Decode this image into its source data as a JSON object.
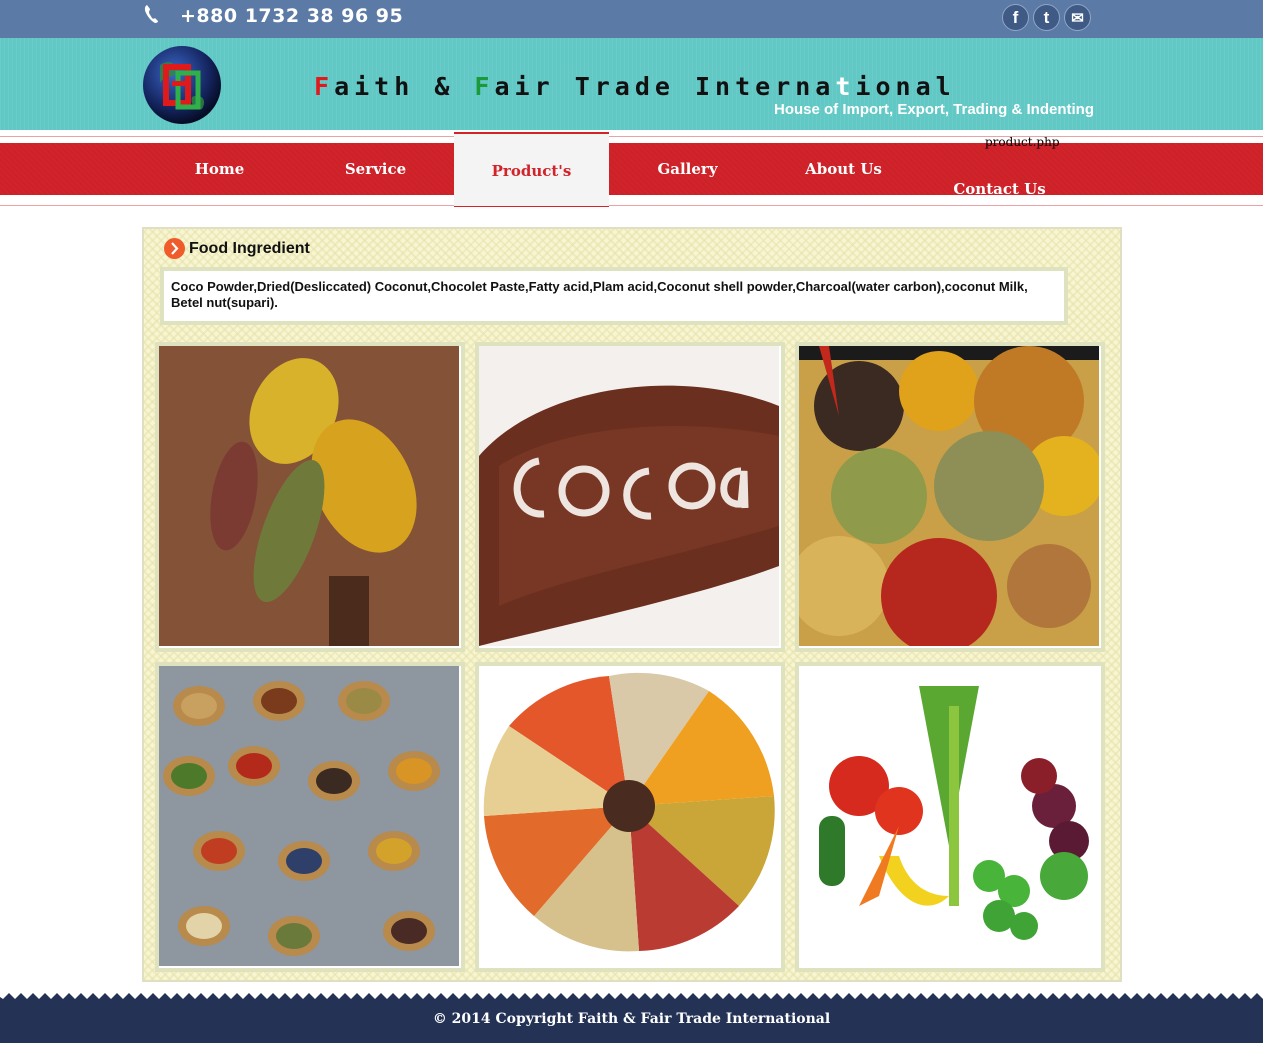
{
  "topbar": {
    "phone": "+880 1732 38 96 95",
    "icons": [
      "phone-icon",
      "facebook-icon",
      "twitter-icon",
      "mail-icon"
    ],
    "facebook_glyph": "f",
    "twitter_glyph": "t",
    "mail_glyph": "✉"
  },
  "header": {
    "brand_f1": "F",
    "brand_aith": "aith & ",
    "brand_f2": "F",
    "brand_rest1": "air Trade Interna",
    "brand_t": "t",
    "brand_rest2": "ional",
    "tagline": "House of Import, Export, Trading & Indenting",
    "logo_letters": "FF"
  },
  "nav": {
    "items": [
      "Home",
      "Service",
      "Product's",
      "Gallery",
      "About Us",
      "Contact Us"
    ],
    "active": "Product's",
    "stray_text": "product.php"
  },
  "section": {
    "title": "Food Ingredient",
    "description": "Coco Powder,Dried(Desliccated) Coconut,Chocolet Paste,Fatty acid,Plam acid,Coconut shell powder,Charcoal(water carbon),coconut Milk, Betel nut(supari)."
  },
  "colors": {
    "topbar": "#5c7aa6",
    "header": "#62c8c6",
    "nav": "#d2232a",
    "panel": "#f7f5d2",
    "footer": "#233255"
  },
  "footer": {
    "copyright": "© 2014 Copyright Faith & Fair Trade International"
  }
}
